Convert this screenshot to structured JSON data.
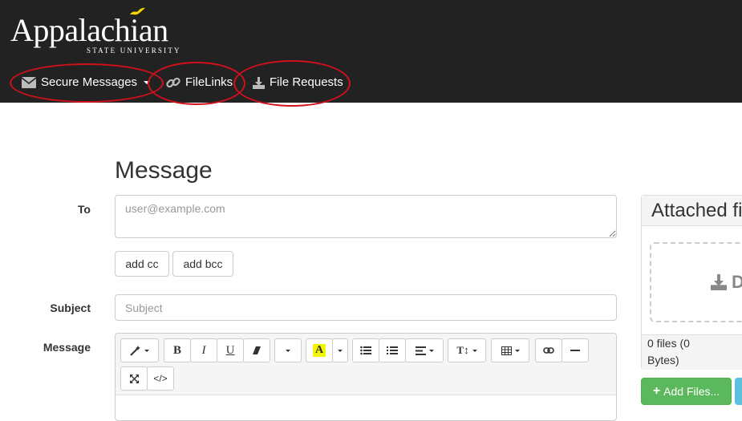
{
  "brand": {
    "name": "Appalachian",
    "tagline": "STATE UNIVERSITY"
  },
  "nav": {
    "secure_messages": "Secure Messages",
    "filelinks": "FileLinks",
    "file_requests": "File Requests"
  },
  "form": {
    "title": "Message",
    "to_label": "To",
    "to_placeholder": "user@example.com",
    "add_cc": "add cc",
    "add_bcc": "add bcc",
    "subject_label": "Subject",
    "subject_placeholder": "Subject",
    "message_label": "Message"
  },
  "toolbar": {
    "bold": "B",
    "italic": "I",
    "underline": "U",
    "highlight": "A",
    "codeview": "</>"
  },
  "attachments": {
    "header": "Attached files",
    "drop_letter": "D",
    "count_text": "0 files (0",
    "bytes_text": "Bytes)",
    "add_files": "Add Files..."
  },
  "colors": {
    "topbar": "#222222",
    "annotation": "#d0101b",
    "success": "#5cb85c",
    "bird": "#f5d400"
  }
}
